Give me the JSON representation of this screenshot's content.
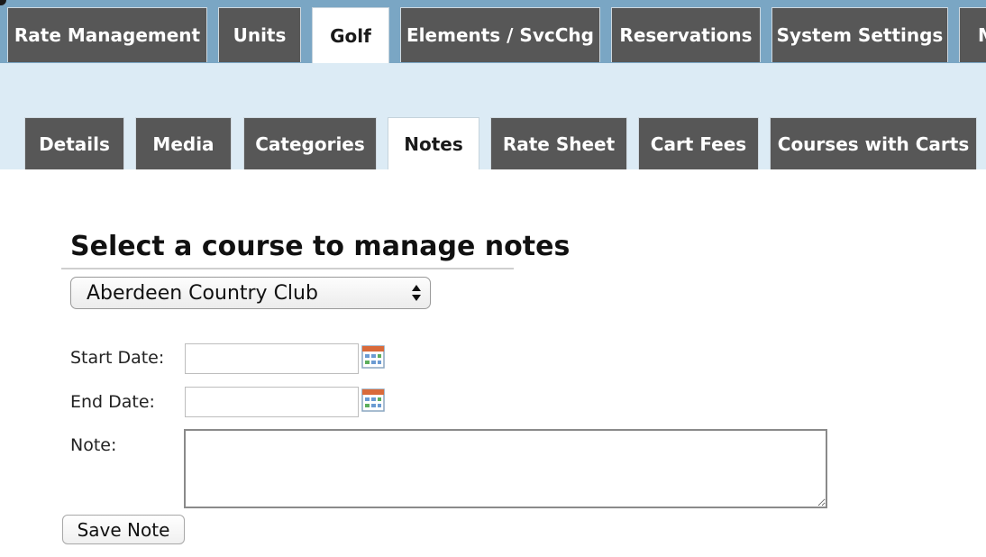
{
  "main_tabs": [
    {
      "label": "Rate Management",
      "active": false
    },
    {
      "label": "Units",
      "active": false
    },
    {
      "label": "Golf",
      "active": true
    },
    {
      "label": "Elements / SvcChg",
      "active": false
    },
    {
      "label": "Reservations",
      "active": false
    },
    {
      "label": "System Settings",
      "active": false
    },
    {
      "label": "M",
      "active": false
    }
  ],
  "sub_tabs": [
    {
      "label": "Details",
      "active": false
    },
    {
      "label": "Media",
      "active": false
    },
    {
      "label": "Categories",
      "active": false
    },
    {
      "label": "Notes",
      "active": true
    },
    {
      "label": "Rate Sheet",
      "active": false
    },
    {
      "label": "Cart Fees",
      "active": false
    },
    {
      "label": "Courses with Carts",
      "active": false
    }
  ],
  "notes_form": {
    "heading": "Select a course to manage notes",
    "course_select": {
      "selected": "Aberdeen Country Club"
    },
    "start_date": {
      "label": "Start Date:",
      "value": ""
    },
    "end_date": {
      "label": "End Date:",
      "value": ""
    },
    "note": {
      "label": "Note:",
      "value": ""
    },
    "save_label": "Save Note"
  },
  "colors": {
    "tab_bg": "#575757",
    "top_strip": "#7aa6c4",
    "sub_strip": "#dcebf5"
  },
  "icons": {
    "calendar": "calendar-icon",
    "select_arrows": "select-arrows-icon"
  }
}
